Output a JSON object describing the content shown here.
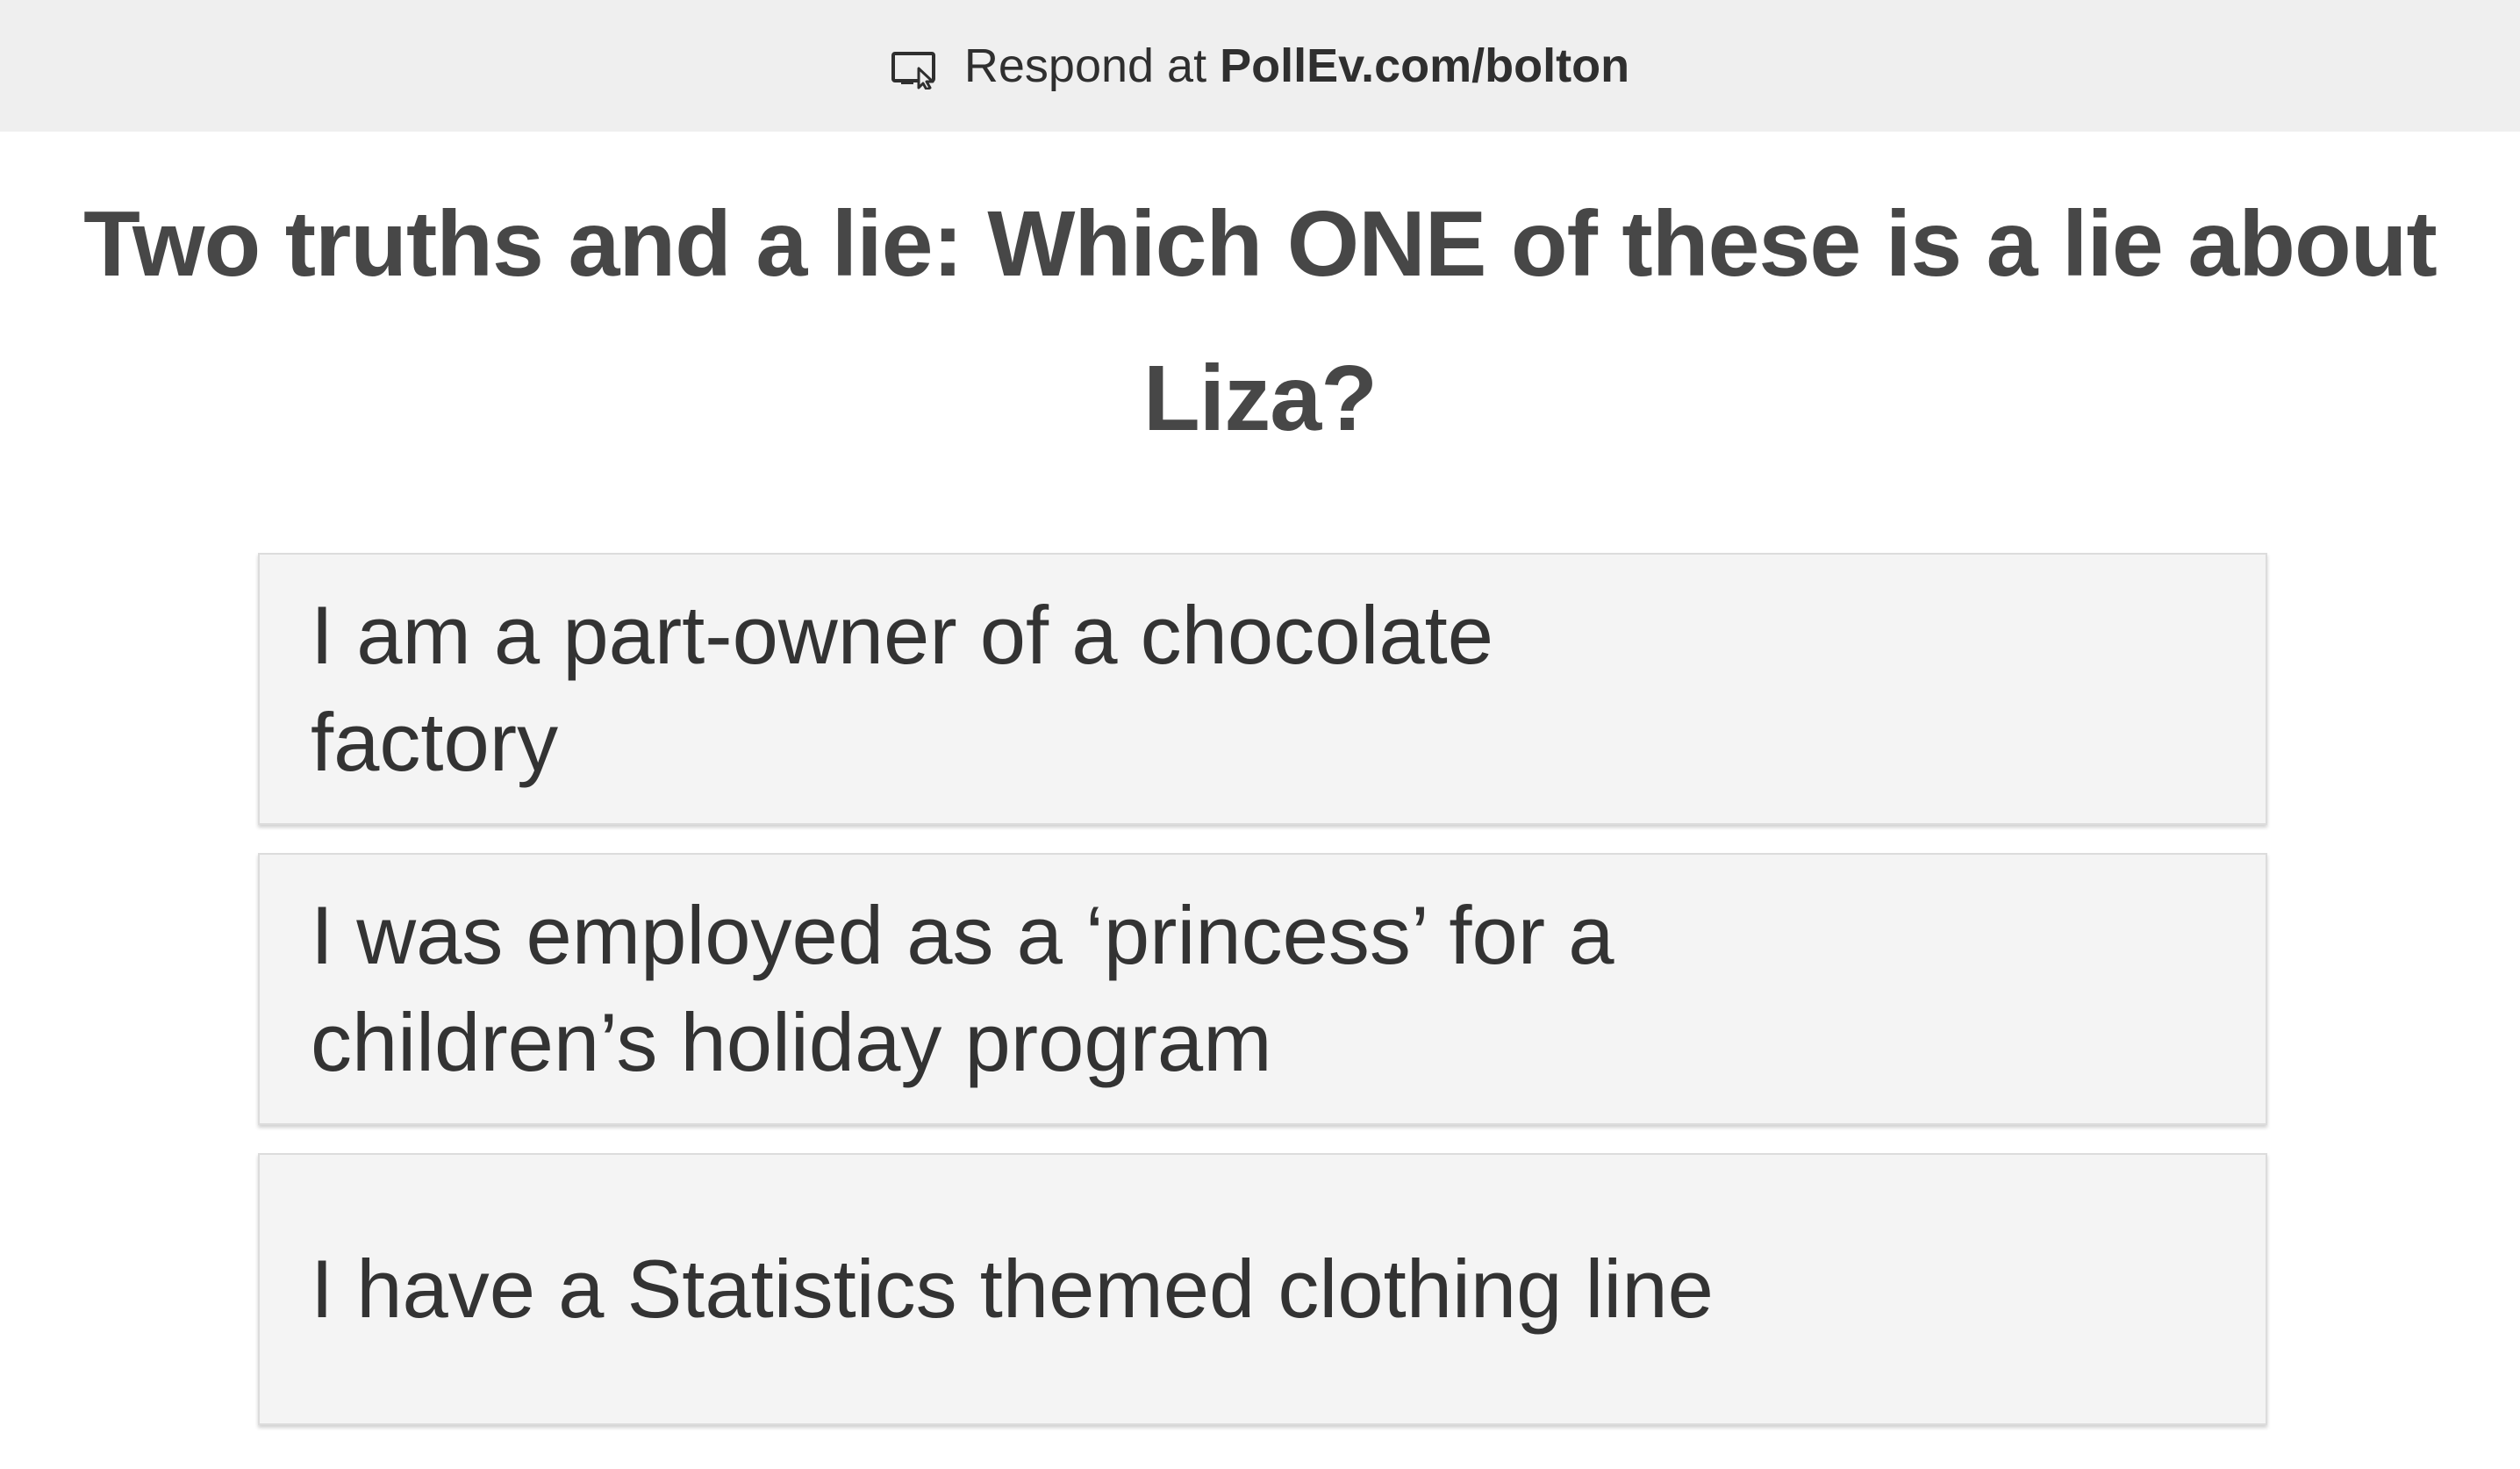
{
  "respond_bar": {
    "icon": "screen-cursor-icon",
    "prefix": "Respond at ",
    "url": "PollEv.com/bolton"
  },
  "question": {
    "title": "Two truths and a lie: Which ONE of these is a lie about Liza?"
  },
  "options": [
    {
      "label": "I am a part-owner of a chocolate factory"
    },
    {
      "label": "I was employed as a ‘princess’ for a children’s holiday program"
    },
    {
      "label": "I have a Statistics themed clothing line"
    }
  ]
}
